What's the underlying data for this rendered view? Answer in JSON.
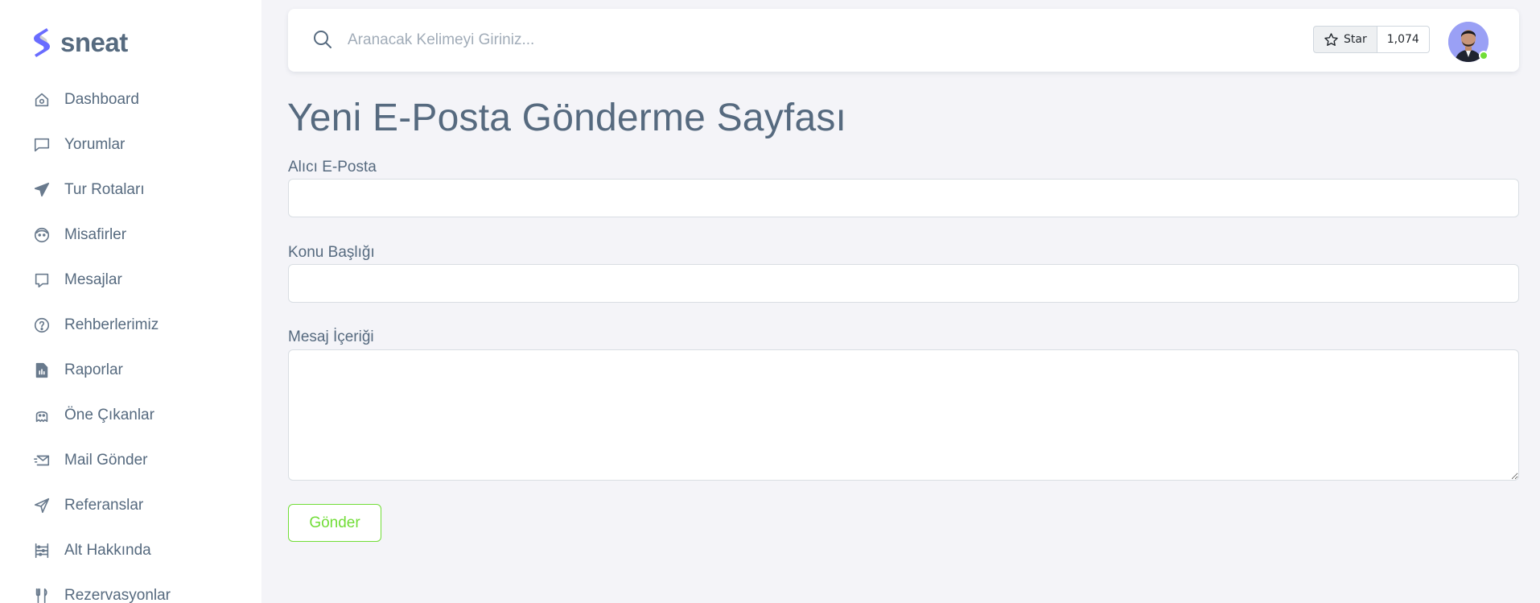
{
  "brand": {
    "name": "sneat",
    "color": "#696cff"
  },
  "sidebar": {
    "items": [
      {
        "label": "Dashboard",
        "icon": "home-icon"
      },
      {
        "label": "Yorumlar",
        "icon": "comment-icon"
      },
      {
        "label": "Tur Rotaları",
        "icon": "plane-icon"
      },
      {
        "label": "Misafirler",
        "icon": "face-icon"
      },
      {
        "label": "Mesajlar",
        "icon": "message-icon"
      },
      {
        "label": "Rehberlerimiz",
        "icon": "help-circle-icon"
      },
      {
        "label": "Raporlar",
        "icon": "report-file-icon"
      },
      {
        "label": "Öne Çıkanlar",
        "icon": "ghost-icon"
      },
      {
        "label": "Mail Gönder",
        "icon": "mail-send-icon"
      },
      {
        "label": "Referanslar",
        "icon": "send-arrow-icon"
      },
      {
        "label": "Alt Hakkında",
        "icon": "abacus-icon"
      },
      {
        "label": "Rezervasyonlar",
        "icon": "restaurant-icon"
      }
    ]
  },
  "navbar": {
    "search": {
      "placeholder": "Aranacak Kelimeyi Giriniz..."
    },
    "github": {
      "star_label": "Star",
      "star_count": "1,074"
    },
    "user": {
      "status_color": "#71dd37"
    }
  },
  "main": {
    "title": "Yeni E-Posta Gönderme Sayfası",
    "fields": {
      "recipient_label": "Alıcı E-Posta",
      "subject_label": "Konu Başlığı",
      "body_label": "Mesaj İçeriği"
    },
    "submit_label": "Gönder",
    "accent_success": "#71dd37"
  }
}
